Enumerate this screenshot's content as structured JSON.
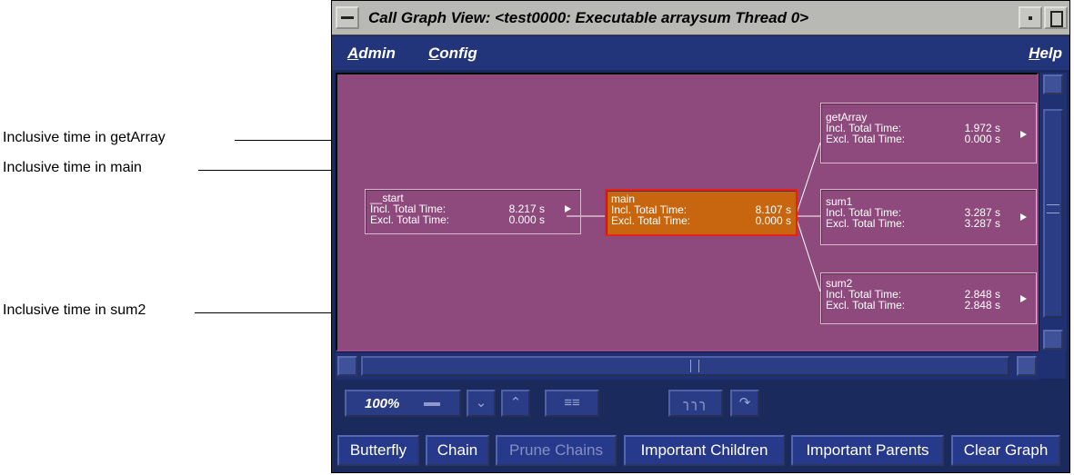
{
  "annotations": {
    "getarray": "Inclusive time in getArray",
    "main": "Inclusive time in main",
    "sum2": "Inclusive time in sum2"
  },
  "window": {
    "title": "Call Graph View: <test0000: Executable arraysum Thread 0>"
  },
  "menubar": {
    "admin": "Admin",
    "config": "Config",
    "help": "Help"
  },
  "graph": {
    "incl_label": "Incl. Total Time:",
    "excl_label": "Excl. Total Time:",
    "nodes": [
      {
        "name": "__start",
        "incl": "8.217 s",
        "excl": "0.000 s",
        "selected": false
      },
      {
        "name": "main",
        "incl": "8.107 s",
        "excl": "0.000 s",
        "selected": true
      },
      {
        "name": "getArray",
        "incl": "1.972 s",
        "excl": "0.000 s",
        "selected": false
      },
      {
        "name": "sum1",
        "incl": "3.287 s",
        "excl": "3.287 s",
        "selected": false
      },
      {
        "name": "sum2",
        "incl": "2.848 s",
        "excl": "2.848 s",
        "selected": false
      }
    ]
  },
  "toolbar": {
    "zoom": "100%"
  },
  "buttons": {
    "butterfly": "Butterfly",
    "chain": "Chain",
    "prune_chains": "Prune Chains",
    "important_children": "Important Children",
    "important_parents": "Important Parents",
    "clear_graph": "Clear Graph"
  },
  "colors": {
    "canvas": "#8e4a7c",
    "selected_node": "#c8660f",
    "chrome": "#1a2a5c"
  }
}
